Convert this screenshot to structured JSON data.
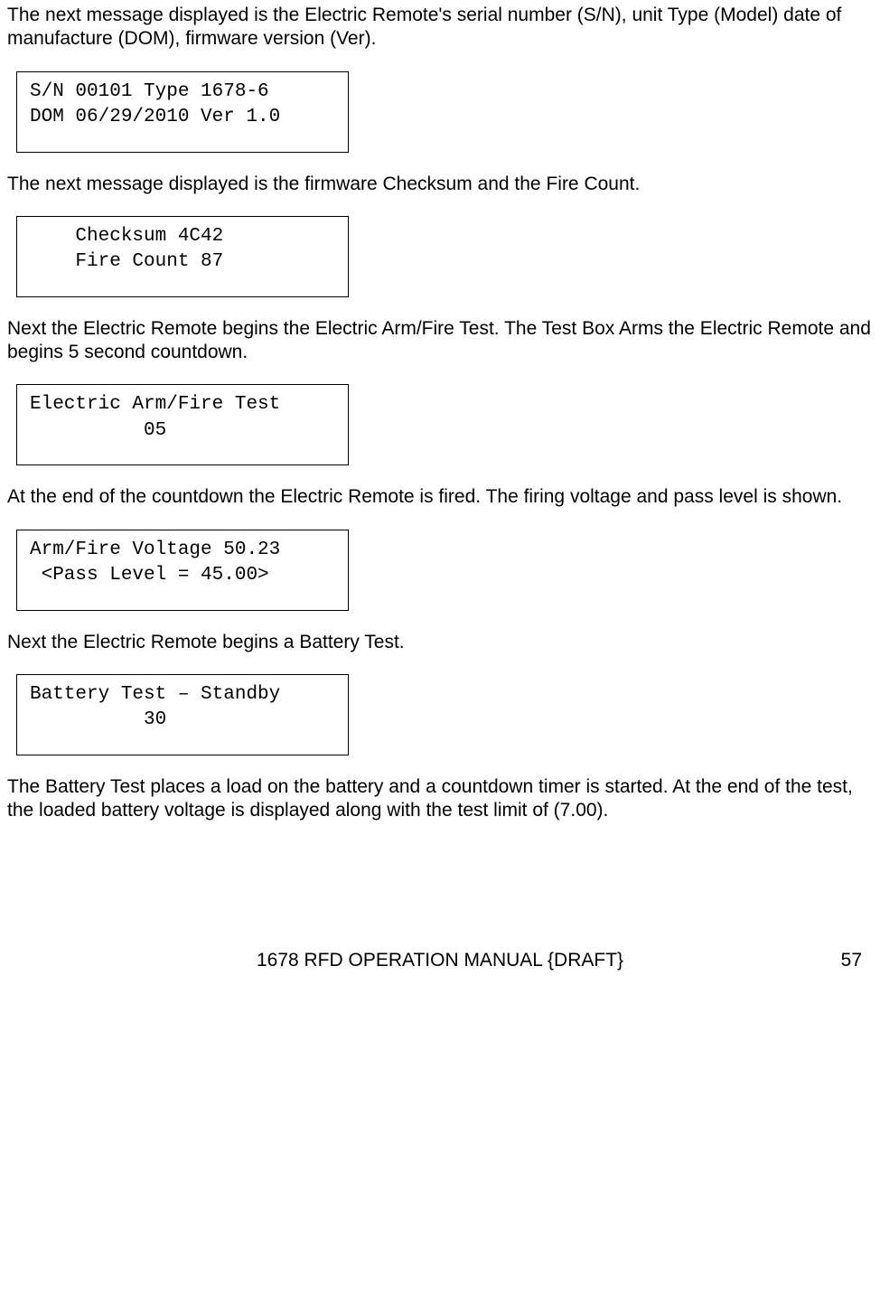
{
  "paragraphs": {
    "p1": "The next message displayed is the Electric Remote's serial number (S/N), unit Type (Model) date of manufacture (DOM), firmware version (Ver).",
    "p2": "The next message displayed is the firmware Checksum and the Fire Count.",
    "p3": " Next the Electric Remote begins the Electric Arm/Fire Test. The Test Box Arms the Electric Remote and begins 5 second countdown.",
    "p4": "At the end of the countdown the Electric Remote is fired. The firing voltage and pass level is shown.",
    "p5": "Next the Electric Remote begins a Battery Test.",
    "p6": "The Battery Test places a load on the battery and a countdown timer is started. At the end of the test, the loaded battery voltage is displayed along with the test limit of (7.00)."
  },
  "displays": {
    "d1": "S/N 00101 Type 1678-6\nDOM 06/29/2010 Ver 1.0",
    "d2": "    Checksum 4C42\n    Fire Count 87",
    "d3": "Electric Arm/Fire Test\n          05",
    "d4": "Arm/Fire Voltage 50.23\n <Pass Level = 45.00>",
    "d5": "Battery Test – Standby\n          30"
  },
  "footer": {
    "title": "1678 RFD OPERATION MANUAL {DRAFT}",
    "page": "57"
  }
}
